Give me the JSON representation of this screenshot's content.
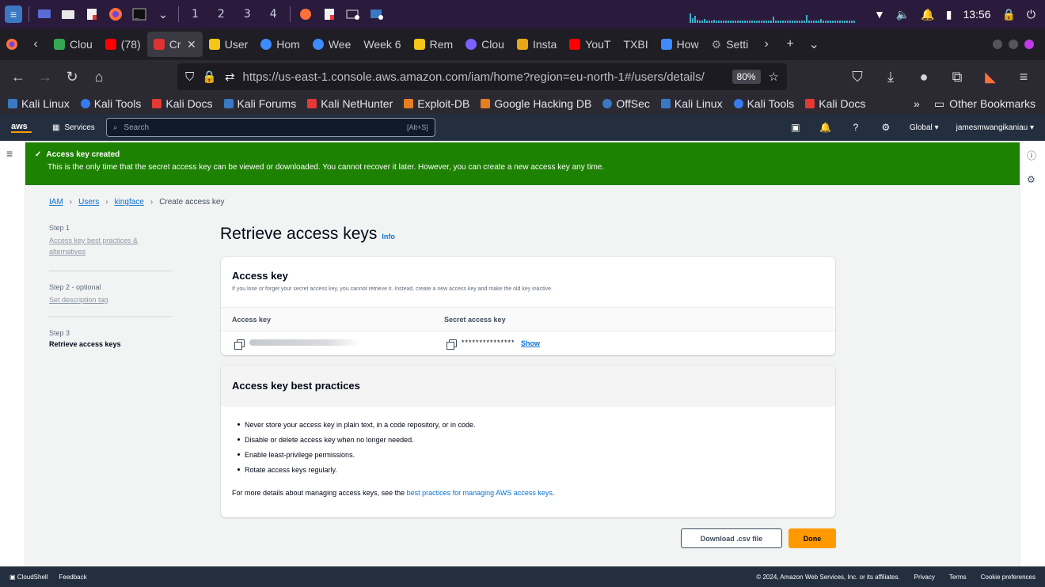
{
  "taskbar": {
    "workspaces": [
      "1",
      "2",
      "3",
      "4"
    ],
    "clock": "13:56"
  },
  "tabs": [
    {
      "label": "Clou",
      "color": "#34a853"
    },
    {
      "label": "(78)",
      "color": "#ff0000"
    },
    {
      "label": "Cr",
      "color": "#dd3333",
      "active": true
    },
    {
      "label": "User",
      "color": "#f5c518"
    },
    {
      "label": "Hom",
      "color": "#3d8bfd"
    },
    {
      "label": "Wee",
      "color": "#3d8bfd"
    },
    {
      "label": "Week 6",
      "color": "#1f1e24"
    },
    {
      "label": "Rem",
      "color": "#f5c518"
    },
    {
      "label": "Clou",
      "color": "#7b61ff"
    },
    {
      "label": "Insta",
      "color": "#e6a817"
    },
    {
      "label": "YouT",
      "color": "#ff0000"
    },
    {
      "label": "TXBI",
      "color": "#1f1e24"
    },
    {
      "label": "How",
      "color": "#3d8bfd"
    },
    {
      "label": "Setti",
      "color": "#9aa0a6"
    }
  ],
  "navbar": {
    "url": "https://us-east-1.console.aws.amazon.com/iam/home?region=eu-north-1#/users/details/",
    "zoom": "80%"
  },
  "bookmarks": [
    {
      "label": "Kali Linux",
      "color": "#3a78c3"
    },
    {
      "label": "Kali Tools",
      "color": "#367bf0"
    },
    {
      "label": "Kali Docs",
      "color": "#e53935"
    },
    {
      "label": "Kali Forums",
      "color": "#3a78c3"
    },
    {
      "label": "Kali NetHunter",
      "color": "#e53935"
    },
    {
      "label": "Exploit-DB",
      "color": "#e67e22"
    },
    {
      "label": "Google Hacking DB",
      "color": "#e67e22"
    },
    {
      "label": "OffSec",
      "color": "#3a78c3"
    },
    {
      "label": "Kali Linux",
      "color": "#3a78c3"
    },
    {
      "label": "Kali Tools",
      "color": "#367bf0"
    },
    {
      "label": "Kali Docs",
      "color": "#e53935"
    }
  ],
  "bookmarks_more": "Other Bookmarks",
  "aws": {
    "logo": "aws",
    "services": "Services",
    "search_placeholder": "Search",
    "search_hint": "[Alt+S]",
    "region": "Global ▾",
    "account": "jamesmwangikaniau ▾"
  },
  "flash": {
    "title": "Access key created",
    "message": "This is the only time that the secret access key can be viewed or downloaded. You cannot recover it later. However, you can create a new access key any time."
  },
  "breadcrumb": {
    "iam": "IAM",
    "users": "Users",
    "user": "kingface",
    "current": "Create access key"
  },
  "steps": [
    {
      "label": "Step 1",
      "title": "Access key best practices & alternatives"
    },
    {
      "label": "Step 2 - optional",
      "title": "Set description tag"
    },
    {
      "label": "Step 3",
      "title": "Retrieve access keys"
    }
  ],
  "page": {
    "title": "Retrieve access keys",
    "info": "Info"
  },
  "access_key_card": {
    "heading": "Access key",
    "subtitle": "If you lose or forget your secret access key, you cannot retrieve it. Instead, create a new access key and make the old key inactive.",
    "col_key": "Access key",
    "col_secret": "Secret access key",
    "secret_masked": "***************",
    "show": "Show"
  },
  "best_practices": {
    "heading": "Access key best practices",
    "items": [
      "Never store your access key in plain text, in a code repository, or in code.",
      "Disable or delete access key when no longer needed.",
      "Enable least-privilege permissions.",
      "Rotate access keys regularly."
    ],
    "more_prefix": "For more details about managing access keys, see the ",
    "more_link": "best practices for managing AWS access keys",
    "more_suffix": "."
  },
  "buttons": {
    "download": "Download .csv file",
    "done": "Done"
  },
  "footer": {
    "cloudshell": "CloudShell",
    "feedback": "Feedback",
    "copyright": "© 2024, Amazon Web Services, Inc. or its affiliates.",
    "privacy": "Privacy",
    "terms": "Terms",
    "cookies": "Cookie preferences"
  }
}
